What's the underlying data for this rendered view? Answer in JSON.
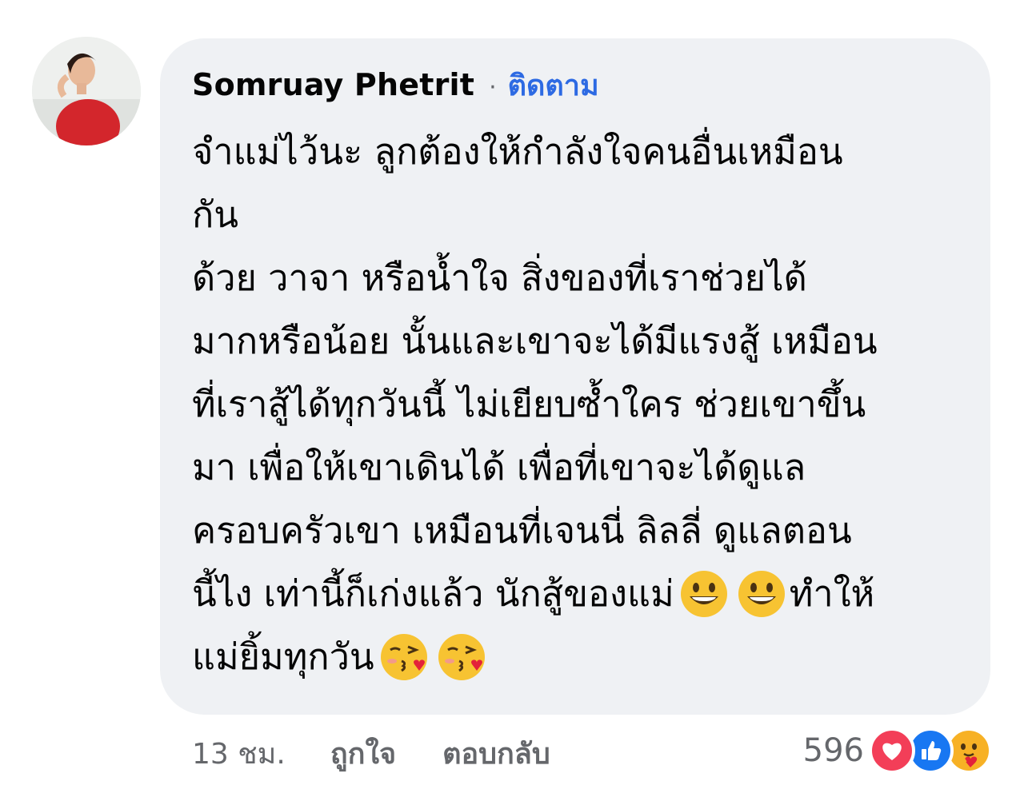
{
  "comment": {
    "author": "Somruay Phetrit",
    "separator": "·",
    "follow_label": "ติดตาม",
    "lines": [
      "จำแม่ไว้นะ ลูกต้องให้กำลังใจคนอื่นเหมือน",
      "กัน",
      "ด้วย วาจา หรือน้ำใจ สิ่งของที่เราช่วยได้",
      "มากหรือน้อย นั้นและเขาจะได้มีแรงสู้ เหมือน",
      "ที่เราสู้ได้ทุกวันนี้ ไม่เยียบซ้ำใคร ช่วยเขาขึ้น",
      "มา เพื่อให้เขาเดินได้ เพื่อที่เขาจะได้ดูแล",
      "ครอบครัวเขา เหมือนที่เจนนี่ ลิลลี่ ดูแลตอน"
    ],
    "line8_text": "นี้ไง เท่านี้ก็เก่งแล้ว นักสู้ของแม่",
    "line8_tail": "ทำให้",
    "line9_text": "แม่ยิ้มทุกวัน",
    "emoji_line8": [
      "grinning-face",
      "grinning-face"
    ],
    "emoji_line9": [
      "face-blowing-kiss",
      "face-blowing-kiss"
    ]
  },
  "footer": {
    "time": "13 ชม.",
    "like_label": "ถูกใจ",
    "reply_label": "ตอบกลับ"
  },
  "reactions": {
    "count": "596",
    "icons": [
      "love-reaction",
      "like-reaction",
      "care-reaction"
    ],
    "colors": {
      "love": "#f33e58",
      "like": "#1877f2",
      "care": "#f7b125"
    }
  },
  "colors": {
    "bubble": "#eff1f4",
    "link": "#2d6ae3",
    "meta": "#65676b"
  }
}
